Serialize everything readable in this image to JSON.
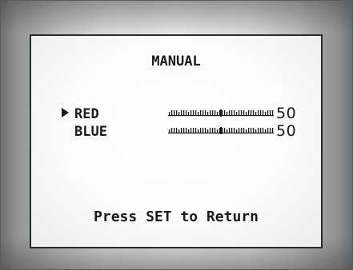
{
  "menu": {
    "title": "MANUAL",
    "items": [
      {
        "label": "RED",
        "value": "50",
        "level": 0.5,
        "selected": true
      },
      {
        "label": "BLUE",
        "value": "50",
        "level": 0.5,
        "selected": false
      }
    ],
    "footer": "Press SET to Return"
  },
  "icons": {
    "cursor": "triangle-right-icon"
  },
  "colors": {
    "text": "#1a1a1a",
    "screen_bg": "#ffffff",
    "bezel": "#b9bbbd"
  }
}
